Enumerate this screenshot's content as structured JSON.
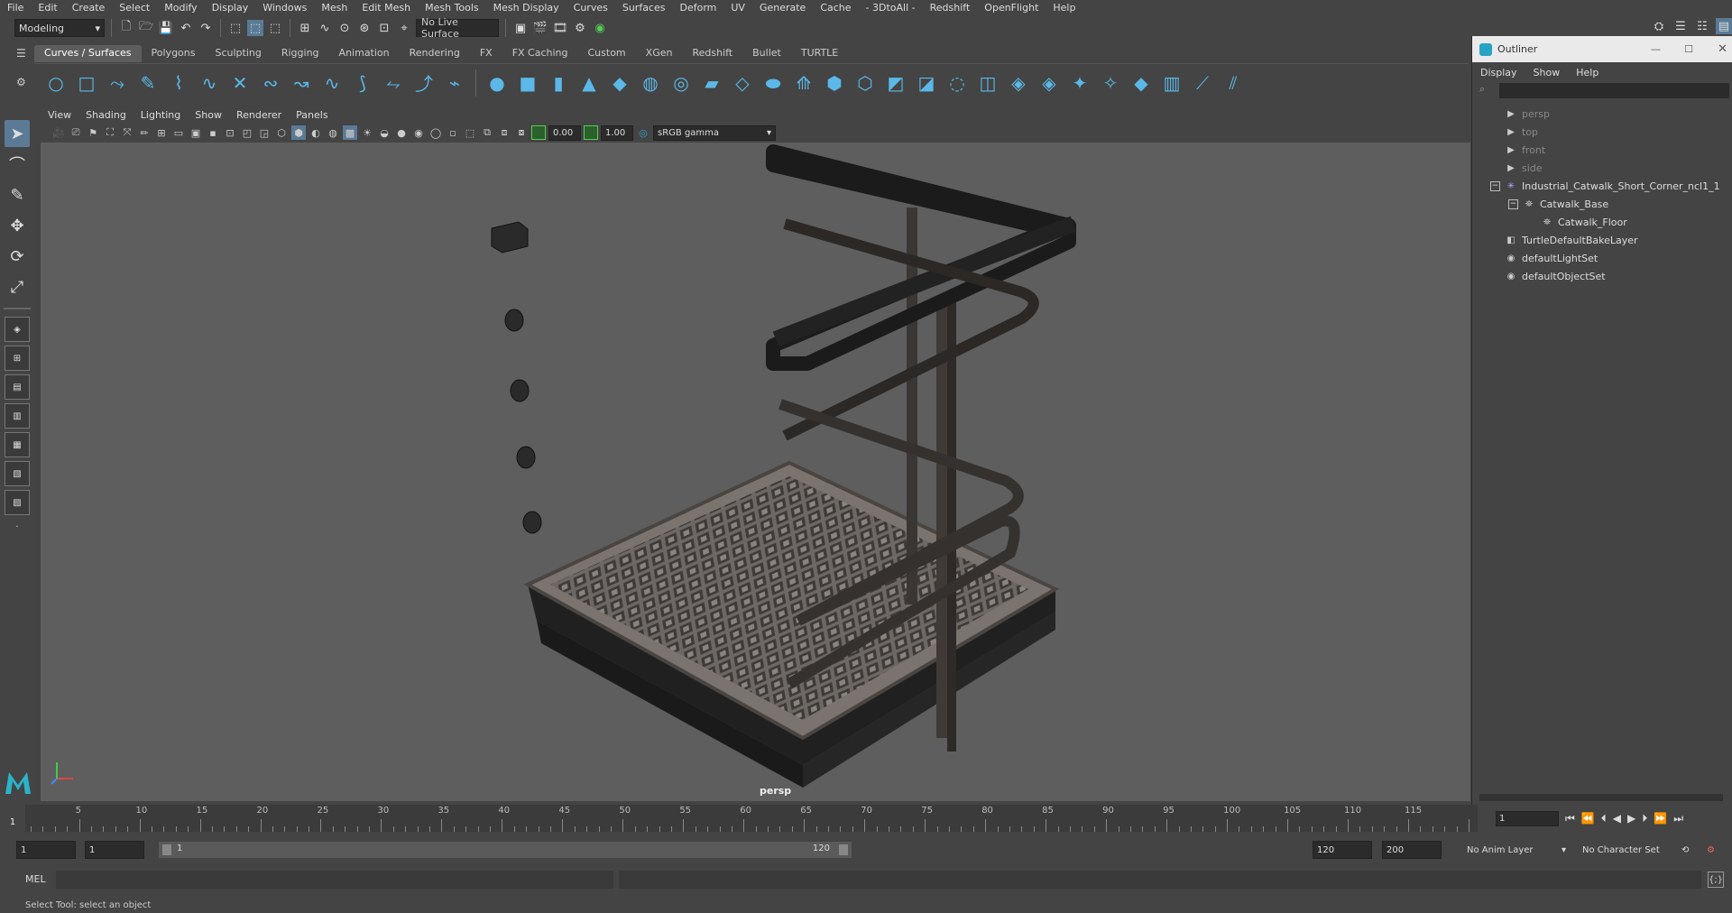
{
  "menubar": {
    "items": [
      "File",
      "Edit",
      "Create",
      "Select",
      "Modify",
      "Display",
      "Windows",
      "Mesh",
      "Edit Mesh",
      "Mesh Tools",
      "Mesh Display",
      "Curves",
      "Surfaces",
      "Deform",
      "UV",
      "Generate",
      "Cache",
      "- 3DtoAll -",
      "Redshift",
      "OpenFlight",
      "Help"
    ]
  },
  "statusline": {
    "workspace": "Modeling",
    "live_surface": "No Live Surface"
  },
  "shelf": {
    "tabs": [
      "Curves / Surfaces",
      "Polygons",
      "Sculpting",
      "Rigging",
      "Animation",
      "Rendering",
      "FX",
      "FX Caching",
      "Custom",
      "XGen",
      "Redshift",
      "Bullet",
      "TURTLE"
    ],
    "active_tab": "Curves / Surfaces"
  },
  "panel": {
    "menus": [
      "View",
      "Shading",
      "Lighting",
      "Show",
      "Renderer",
      "Panels"
    ],
    "exposure": "0.00",
    "gamma": "1.00",
    "color_space": "sRGB gamma",
    "camera_label": "persp"
  },
  "outliner": {
    "title": "Outliner",
    "menus": [
      "Display",
      "Show",
      "Help"
    ],
    "items": [
      {
        "label": "persp",
        "dim": true,
        "indent": 0,
        "icon": "camera-icon"
      },
      {
        "label": "top",
        "dim": true,
        "indent": 0,
        "icon": "camera-icon"
      },
      {
        "label": "front",
        "dim": true,
        "indent": 0,
        "icon": "camera-icon"
      },
      {
        "label": "side",
        "dim": true,
        "indent": 0,
        "icon": "camera-icon"
      },
      {
        "label": "Industrial_Catwalk_Short_Corner_ncl1_1",
        "dim": false,
        "indent": 0,
        "icon": "group-icon",
        "expander": "−"
      },
      {
        "label": "Catwalk_Base",
        "dim": false,
        "indent": 1,
        "icon": "mesh-icon",
        "expander": "−"
      },
      {
        "label": "Catwalk_Floor",
        "dim": false,
        "indent": 2,
        "icon": "mesh-icon"
      },
      {
        "label": "TurtleDefaultBakeLayer",
        "dim": false,
        "indent": 0,
        "icon": "bake-layer-icon"
      },
      {
        "label": "defaultLightSet",
        "dim": false,
        "indent": 0,
        "icon": "set-icon"
      },
      {
        "label": "defaultObjectSet",
        "dim": false,
        "indent": 0,
        "icon": "set-icon"
      }
    ]
  },
  "timeline": {
    "ticks": [
      "5",
      "10",
      "15",
      "20",
      "25",
      "30",
      "35",
      "40",
      "45",
      "50",
      "55",
      "60",
      "65",
      "70",
      "75",
      "80",
      "85",
      "90",
      "95",
      "100",
      "105",
      "110",
      "115"
    ],
    "current_frame": "1",
    "current_frame_field": "1"
  },
  "range": {
    "start": "1",
    "playback_start": "1",
    "slider_start": "1",
    "slider_end": "120",
    "playback_end": "120",
    "end": "200",
    "anim_layer": "No Anim Layer",
    "character_set": "No Character Set"
  },
  "command": {
    "lang": "MEL"
  },
  "helpline": {
    "text": "Select Tool: select an object"
  }
}
